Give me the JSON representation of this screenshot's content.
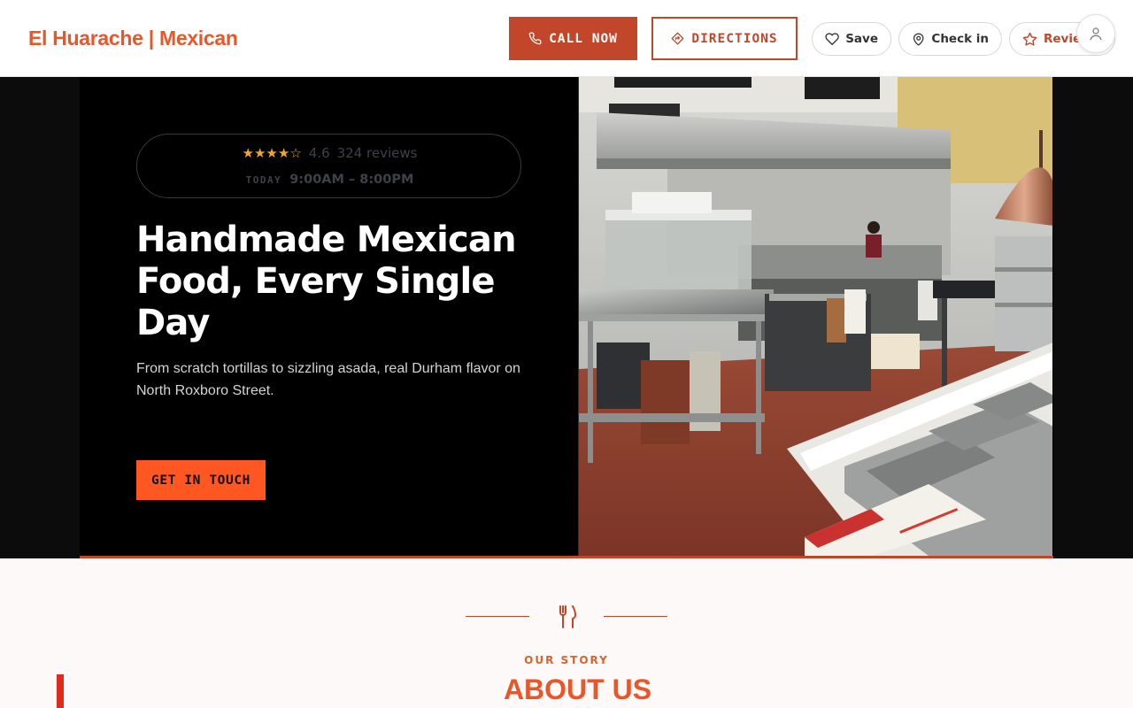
{
  "header": {
    "brand": "El Huarache | Mexican",
    "call_label": "CALL NOW",
    "directions_label": "DIRECTIONS",
    "save_label": "Save",
    "checkin_label": "Check in",
    "review_label": "Review"
  },
  "hero": {
    "rating": {
      "stars": "★★★★☆",
      "score": "4.6",
      "count": "324 reviews",
      "today_label": "TODAY",
      "hours": "9:00AM – 8:00PM"
    },
    "title": "Handmade Mexican Food, Every Single Day",
    "subtitle": "From scratch tortillas to sizzling asada, real Durham flavor on North Roxboro Street.",
    "cta_label": "GET IN TOUCH"
  },
  "about": {
    "eyebrow": "OUR STORY",
    "title": "ABOUT US"
  },
  "colors": {
    "brand": "#e8572a",
    "call_bg": "#c2472a",
    "cta_bg": "#ff5722",
    "star": "#f5a623"
  }
}
